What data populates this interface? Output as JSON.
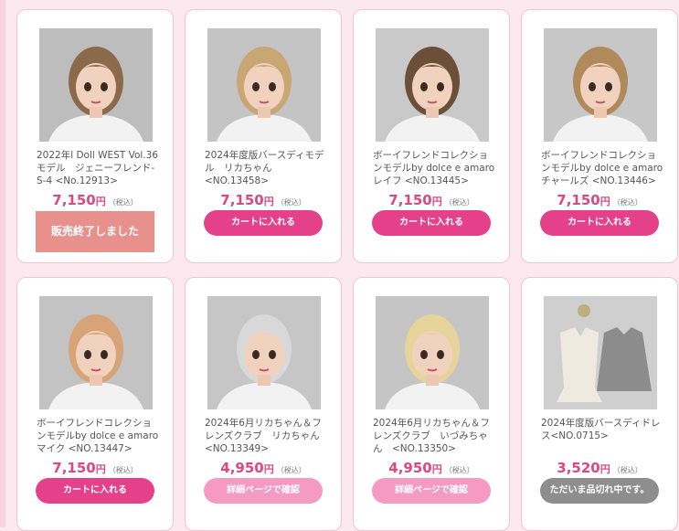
{
  "products": [
    {
      "title": "2022年l Doll WEST Vol.36\nモデル　ジェニーフレンド-\nS-4 <No.12913>",
      "price": "7,150",
      "yen": "円",
      "tax": "（税込）",
      "button": "販売終了しました",
      "button_type": "soldout",
      "hair": "#8a6a4a",
      "bg": "#bdbdbd"
    },
    {
      "title": "2024年度版バースディモデ\nル　リカちゃん\n<NO.13458>",
      "price": "7,150",
      "yen": "円",
      "tax": "（税込）",
      "button": "カートに入れる",
      "button_type": "cart",
      "hair": "#c8a775",
      "bg": "#c4c4c4"
    },
    {
      "title": "ボーイフレンドコレクショ\nンモデルby dolce e amaro\nレイフ <NO.13445>",
      "price": "7,150",
      "yen": "円",
      "tax": "（税込）",
      "button": "カートに入れる",
      "button_type": "cart",
      "hair": "#6b4f38",
      "bg": "#c9c9c9"
    },
    {
      "title": "ボーイフレンドコレクショ\nンモデルby dolce e amaro\nチャールズ <NO.13446>",
      "price": "7,150",
      "yen": "円",
      "tax": "（税込）",
      "button": "カートに入れる",
      "button_type": "cart",
      "hair": "#b08a5a",
      "bg": "#c7c7c7"
    },
    {
      "title": "ボーイフレンドコレクショ\nンモデルby dolce e amaro\nマイク <NO.13447>",
      "price": "7,150",
      "yen": "円",
      "tax": "（税込）",
      "button": "カートに入れる",
      "button_type": "cart",
      "hair": "#d7a477",
      "bg": "#c3c3c3"
    },
    {
      "title": "2024年6月リカちゃん＆フ\nレンズクラブ　リカちゃん\n<NO.13349>",
      "price": "4,950",
      "yen": "円",
      "tax": "（税込）",
      "button": "詳細ページで確認",
      "button_type": "detail",
      "hair": "#d8d8d8",
      "bg": "#c6c6c6"
    },
    {
      "title": "2024年6月リカちゃん＆フ\nレンズクラブ　いづみちゃ\nん　<NO.13350>",
      "price": "4,950",
      "yen": "円",
      "tax": "（税込）",
      "button": "詳細ページで確認",
      "button_type": "detail",
      "hair": "#e6d49a",
      "bg": "#c5c5c5"
    },
    {
      "title": "2024年度版バースディドレ\nス<NO.0715>",
      "price": "3,520",
      "yen": "円",
      "tax": "（税込）",
      "button": "ただいま品切れ中です。",
      "button_type": "soldout-wait",
      "hair": "",
      "bg": "#cfcfcf"
    }
  ]
}
